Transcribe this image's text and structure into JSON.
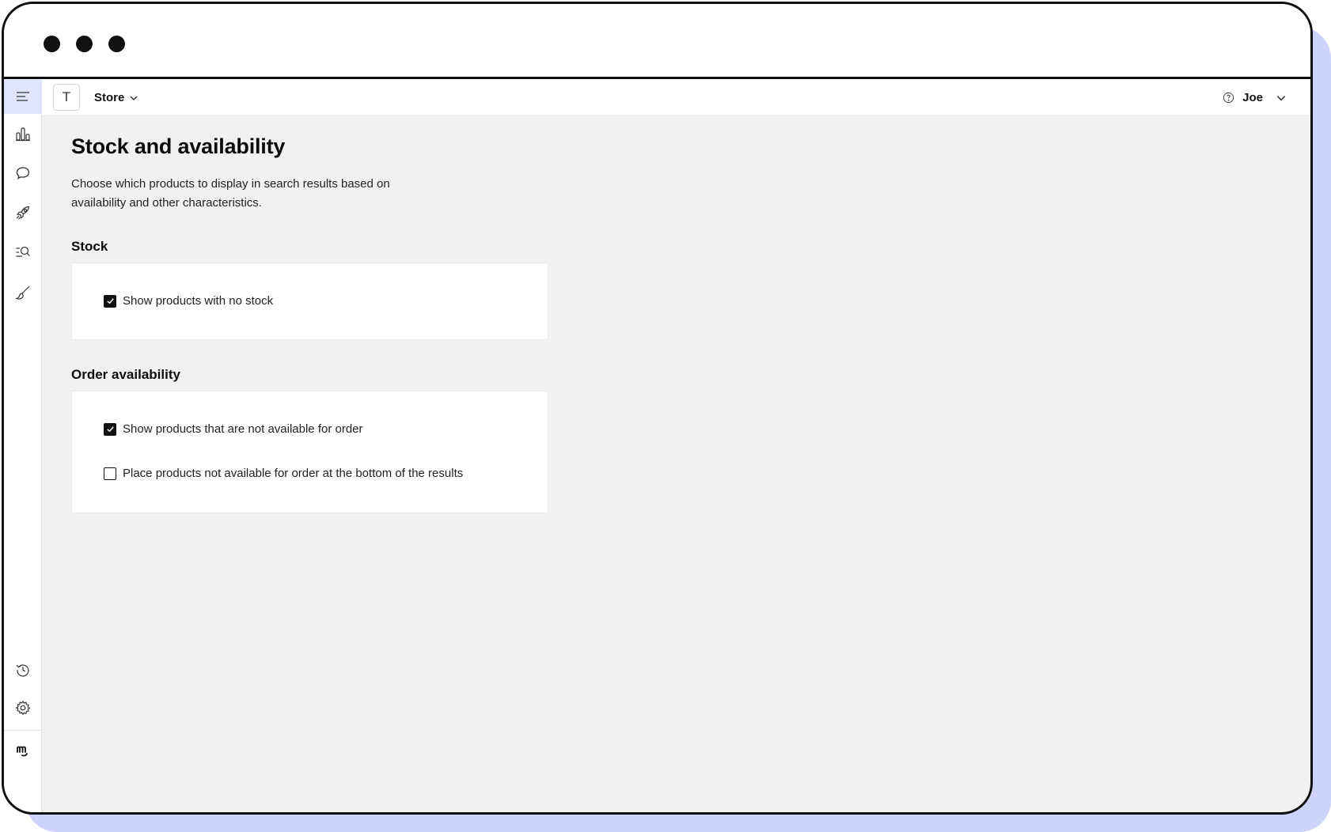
{
  "header": {
    "store_initial": "T",
    "store_name": "Store",
    "user_name": "Joe"
  },
  "sidebar": {
    "items": [
      {
        "name": "menu-icon"
      },
      {
        "name": "analytics-icon"
      },
      {
        "name": "chat-icon"
      },
      {
        "name": "rocket-icon"
      },
      {
        "name": "search-list-icon"
      },
      {
        "name": "brush-icon"
      },
      {
        "name": "history-icon"
      },
      {
        "name": "gear-icon"
      },
      {
        "name": "logo-icon"
      }
    ]
  },
  "page": {
    "title": "Stock and availability",
    "description": "Choose which products to display in search results based on availability and other characteristics."
  },
  "sections": {
    "stock": {
      "title": "Stock",
      "options": [
        {
          "label": "Show products with no stock",
          "checked": true
        }
      ]
    },
    "order": {
      "title": "Order availability",
      "options": [
        {
          "label": "Show products that are not available for order",
          "checked": true
        },
        {
          "label": "Place products not available for order at the bottom of the results",
          "checked": false
        }
      ]
    }
  },
  "colors": {
    "accent_frame": "#cdd3fb",
    "active_nav": "#dfe5fc",
    "background": "#f1f1f1"
  }
}
